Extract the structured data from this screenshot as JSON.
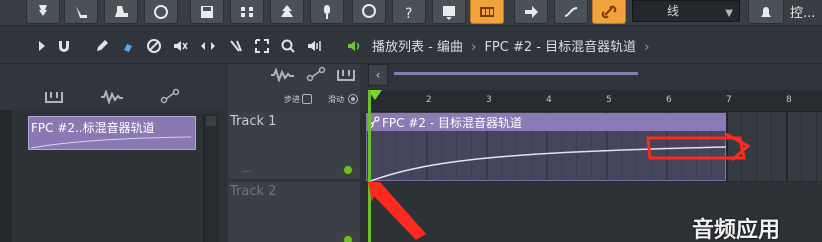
{
  "toolbar": {
    "buttons": [
      {
        "icon": "pin-icon"
      },
      {
        "icon": "fork-icon"
      },
      {
        "icon": "boot-icon"
      },
      {
        "icon": "paint-icon"
      },
      {
        "icon": "loop-icon"
      },
      {
        "icon": "save-icon"
      },
      {
        "icon": "step-icon"
      },
      {
        "icon": "tree-icon"
      },
      {
        "icon": "mic-icon"
      },
      {
        "icon": "speech-icon"
      },
      {
        "icon": "help-icon"
      },
      {
        "icon": "window-icon"
      },
      {
        "icon": "grid-icon"
      },
      {
        "icon": "arrow-right-icon"
      },
      {
        "icon": "lines-icon"
      },
      {
        "icon": "link-icon"
      }
    ],
    "combo_value": "线",
    "ctrl_label": "控..."
  },
  "toolbar2": {
    "title": "播放列表 - 编曲",
    "breadcrumb_sep": "›",
    "pattern": "FPC #2 - 目标混音器轨道"
  },
  "browser": {
    "clip_label": "FPC #2..标混音器轨道"
  },
  "headers": {
    "step_label": "步进",
    "slide_label": "滑动"
  },
  "tracks": [
    {
      "name": "Track 1",
      "dots": "..."
    },
    {
      "name": "Track 2"
    }
  ],
  "ruler": {
    "numbers": [
      "2",
      "3",
      "4",
      "5",
      "6",
      "7",
      "8"
    ]
  },
  "clip": {
    "label": "FPC #2 - 目标混音器轨道"
  },
  "watermark": "音频应用",
  "colors": {
    "accent": "#f2a23c",
    "clip": "#8b7ab5",
    "playhead": "#6ec02c",
    "annotation": "#ff2a1f"
  }
}
